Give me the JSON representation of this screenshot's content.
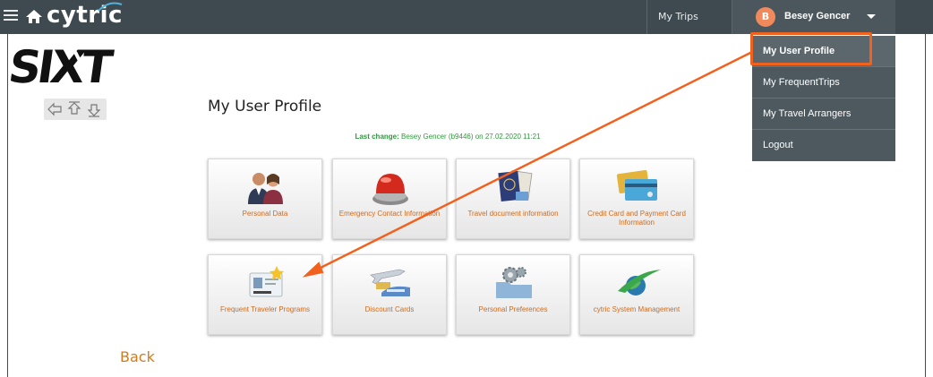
{
  "topbar": {
    "brand": "cytric",
    "nav_mytrips": "My Trips",
    "user_initial": "B",
    "user_name": "Besey Gencer"
  },
  "user_menu": {
    "items": [
      {
        "label": "My User Profile"
      },
      {
        "label": "My FrequentTrips"
      },
      {
        "label": "My Travel Arrangers"
      },
      {
        "label": "Logout"
      }
    ]
  },
  "logo": {
    "text": "SIXT"
  },
  "page": {
    "title": "My User Profile",
    "last_change_label": "Last change:",
    "last_change_value": "Besey Gencer (b9446) on 27.02.2020 11:21",
    "back_label": "Back"
  },
  "tiles": [
    {
      "label": "Personal Data",
      "icon": "people-icon"
    },
    {
      "label": "Emergency Contact Information",
      "icon": "alarm-button-icon"
    },
    {
      "label": "Travel document information",
      "icon": "passport-icon"
    },
    {
      "label": "Credit Card and Payment Card Information",
      "icon": "credit-card-icon"
    },
    {
      "label": "Frequent Traveler Programs",
      "icon": "id-card-star-icon"
    },
    {
      "label": "Discount Cards",
      "icon": "plane-train-icon"
    },
    {
      "label": "Personal Preferences",
      "icon": "gears-folder-icon"
    },
    {
      "label": "cytric System Management",
      "icon": "globe-swoosh-icon"
    }
  ],
  "colors": {
    "topbar": "#3f4a50",
    "accent_orange": "#f0621e",
    "tile_label": "#d36a1a",
    "last_change_green": "#2e9a3c"
  }
}
